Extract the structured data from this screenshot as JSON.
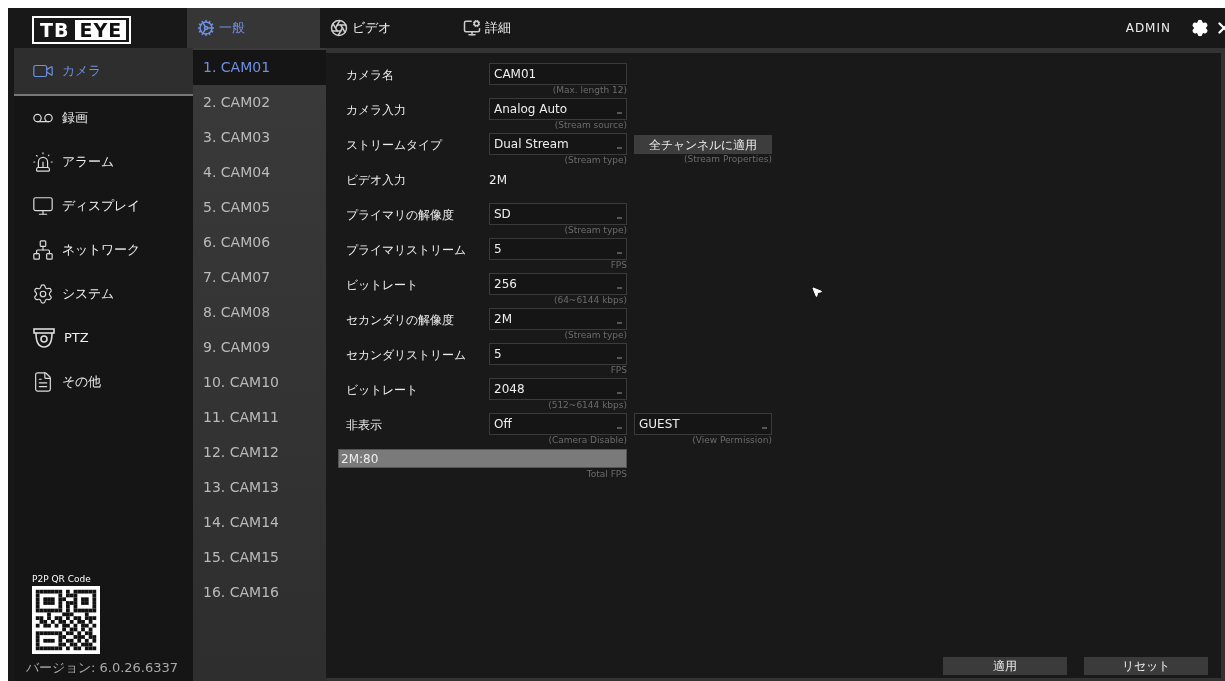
{
  "header": {
    "logo": {
      "left": "TB",
      "right": "EYE"
    },
    "tabs": [
      {
        "label": "一般",
        "selected": true
      },
      {
        "label": "ビデオ",
        "selected": false
      },
      {
        "label": "詳細",
        "selected": false
      }
    ],
    "user": "ADMIN"
  },
  "sidebar": {
    "items": [
      {
        "label": "カメラ",
        "selected": true
      },
      {
        "label": "録画",
        "selected": false
      },
      {
        "label": "アラーム",
        "selected": false
      },
      {
        "label": "ディスプレイ",
        "selected": false
      },
      {
        "label": "ネットワーク",
        "selected": false
      },
      {
        "label": "システム",
        "selected": false
      },
      {
        "label": "PTZ",
        "selected": false
      },
      {
        "label": "その他",
        "selected": false
      }
    ],
    "qr_label": "P2P QR Code",
    "version": "バージョン: 6.0.26.6337"
  },
  "cameras": [
    {
      "label": "1. CAM01",
      "selected": true
    },
    {
      "label": "2. CAM02",
      "selected": false
    },
    {
      "label": "3. CAM03",
      "selected": false
    },
    {
      "label": "4. CAM04",
      "selected": false
    },
    {
      "label": "5. CAM05",
      "selected": false
    },
    {
      "label": "6. CAM06",
      "selected": false
    },
    {
      "label": "7. CAM07",
      "selected": false
    },
    {
      "label": "8. CAM08",
      "selected": false
    },
    {
      "label": "9. CAM09",
      "selected": false
    },
    {
      "label": "10. CAM10",
      "selected": false
    },
    {
      "label": "11. CAM11",
      "selected": false
    },
    {
      "label": "12. CAM12",
      "selected": false
    },
    {
      "label": "13. CAM13",
      "selected": false
    },
    {
      "label": "14. CAM14",
      "selected": false
    },
    {
      "label": "15. CAM15",
      "selected": false
    },
    {
      "label": "16. CAM16",
      "selected": false
    }
  ],
  "form": {
    "rows": [
      {
        "label": "カメラ名",
        "kind": "text",
        "value": "CAM01",
        "hint": "(Max. length 12)"
      },
      {
        "label": "カメラ入力",
        "kind": "select",
        "value": "Analog Auto",
        "hint": "(Stream source)"
      },
      {
        "label": "ストリームタイプ",
        "kind": "select",
        "value": "Dual Stream",
        "hint": "(Stream type)",
        "extra": {
          "kind": "button",
          "value": "全チャンネルに適用",
          "hint": "(Stream Properties)"
        }
      },
      {
        "label": "ビデオ入力",
        "kind": "static",
        "value": "2M"
      },
      {
        "label": "プライマリの解像度",
        "kind": "select",
        "value": "SD",
        "hint": "(Stream type)"
      },
      {
        "label": "プライマリストリーム",
        "kind": "select",
        "value": "5",
        "hint": "FPS"
      },
      {
        "label": "ビットレート",
        "kind": "select",
        "value": "256",
        "hint": "(64~6144 kbps)"
      },
      {
        "label": "セカンダリの解像度",
        "kind": "select",
        "value": "2M",
        "hint": "(Stream type)"
      },
      {
        "label": "セカンダリストリーム",
        "kind": "select",
        "value": "5",
        "hint": "FPS"
      },
      {
        "label": "ビットレート",
        "kind": "select",
        "value": "2048",
        "hint": "(512~6144 kbps)"
      },
      {
        "label": "非表示",
        "kind": "select",
        "value": "Off",
        "hint": "(Camera Disable)",
        "extra": {
          "kind": "select",
          "value": "GUEST",
          "hint": "(View Permission)"
        }
      }
    ],
    "total_fps": {
      "value": "2M:80",
      "hint": "Total FPS"
    }
  },
  "buttons": [
    "適用",
    "リセット"
  ]
}
